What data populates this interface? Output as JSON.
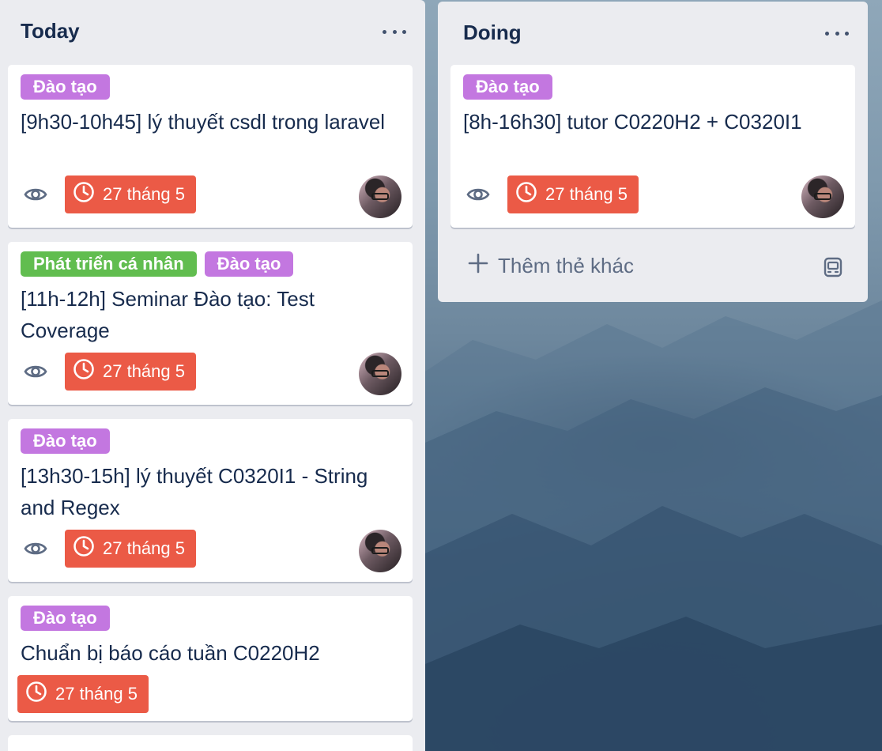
{
  "lists": [
    {
      "title": "Today",
      "cards": [
        {
          "labels": [
            "Đào tạo"
          ],
          "title": "[9h30-10h45] lý thuyết csdl trong laravel",
          "due": "27 tháng 5"
        },
        {
          "labels": [
            "Phát triển cá nhân",
            "Đào tạo"
          ],
          "title": "[11h-12h] Seminar Đào tạo: Test Coverage",
          "due": "27 tháng 5"
        },
        {
          "labels": [
            "Đào tạo"
          ],
          "title": "[13h30-15h] lý thuyết C0320I1 - String and Regex",
          "due": "27 tháng 5"
        },
        {
          "labels": [
            "Đào tạo"
          ],
          "title": "Chuẩn bị báo cáo tuần C0220H2",
          "due": "27 tháng 5"
        }
      ]
    },
    {
      "title": "Doing",
      "cards": [
        {
          "labels": [
            "Đào tạo"
          ],
          "title": "[8h-16h30] tutor C0220H2 + C0320I1",
          "due": "27 tháng 5"
        }
      ],
      "add_card_label": "Thêm thẻ khác"
    }
  ],
  "colors": {
    "label_purple": "#c377e0",
    "label_green": "#61bd4f",
    "due_red": "#eb5a46",
    "list_bg": "#ebecf0"
  }
}
